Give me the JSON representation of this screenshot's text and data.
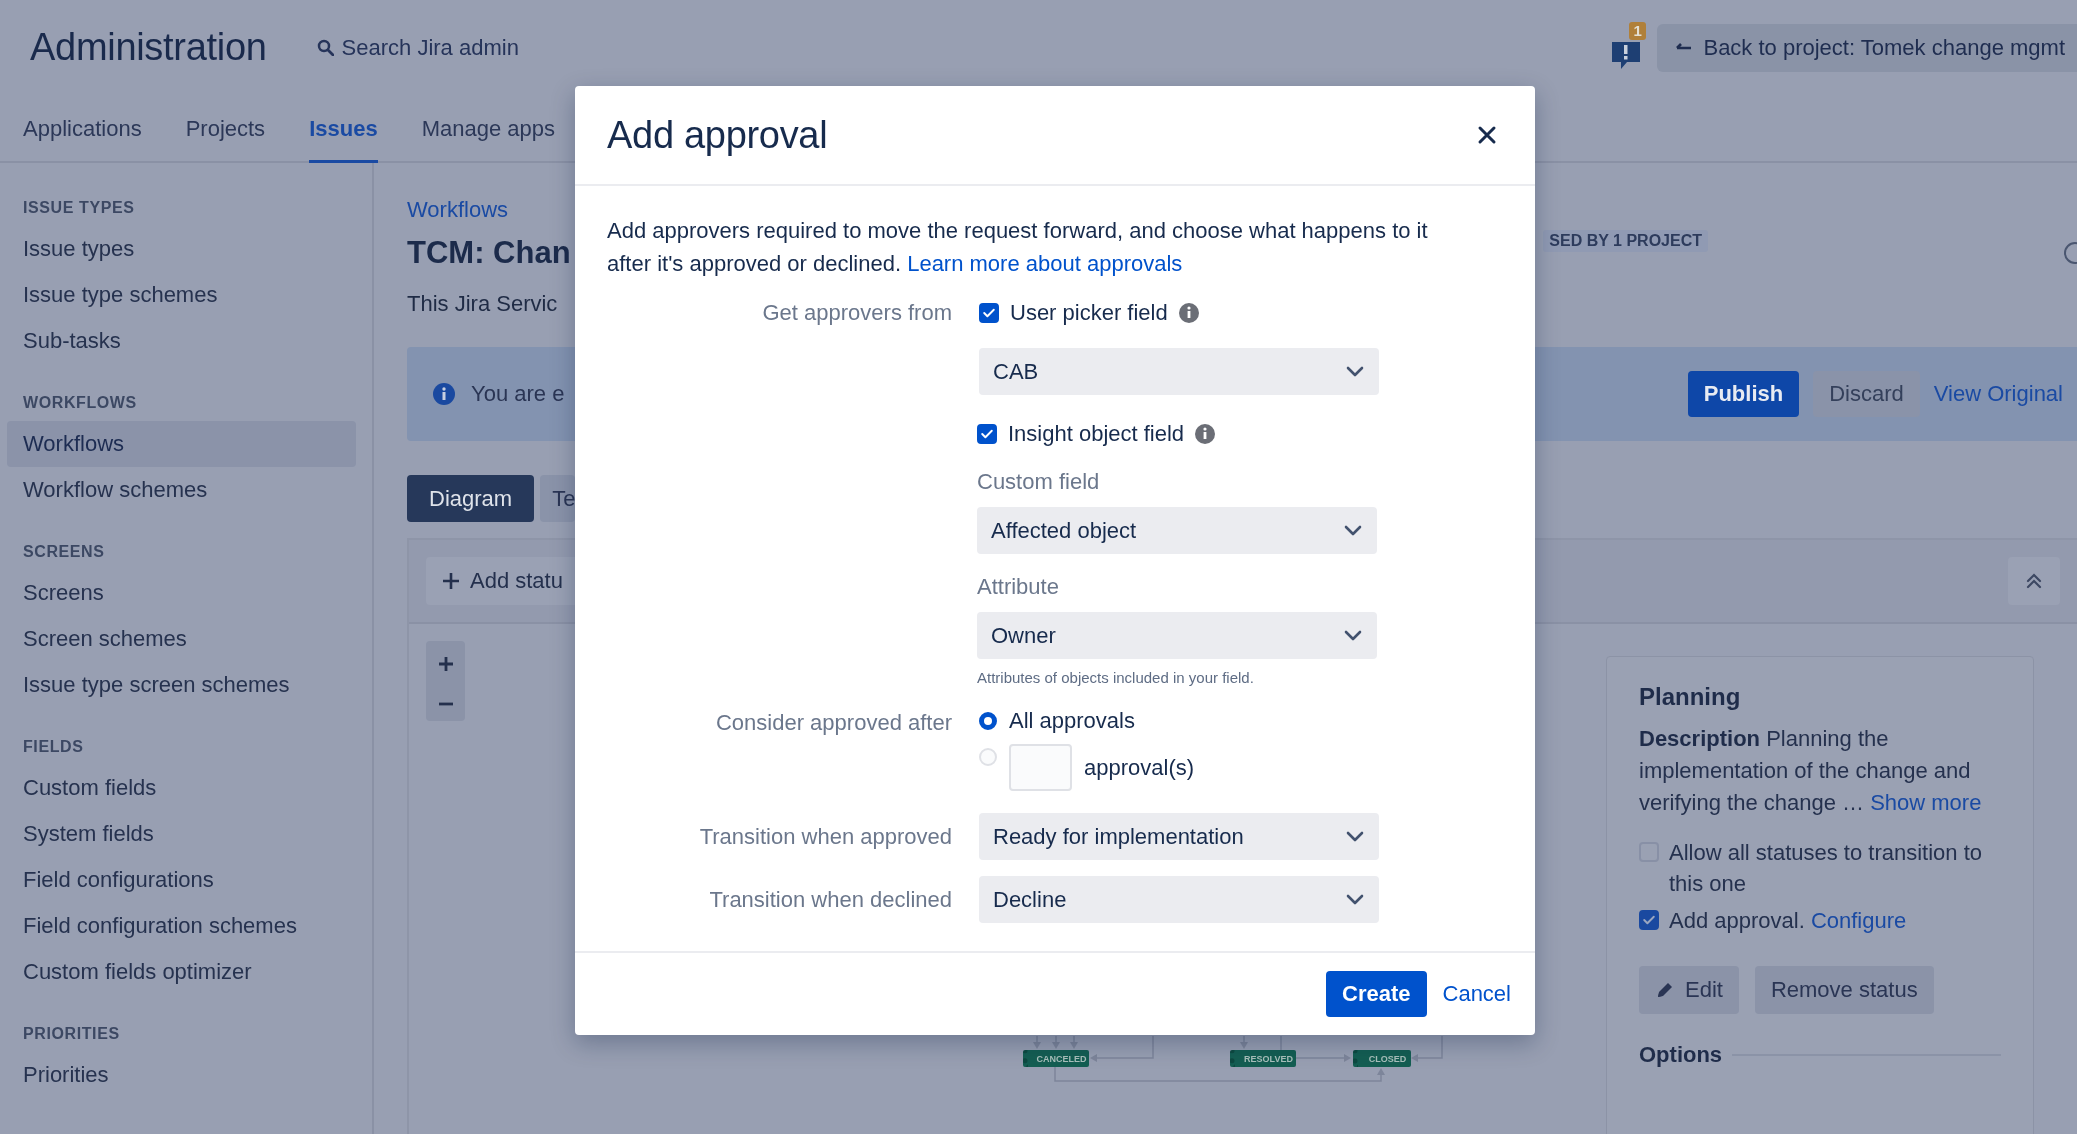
{
  "header": {
    "title": "Administration",
    "search_placeholder": "Search Jira admin",
    "notification_count": "1",
    "back_button": "Back to project: Tomek change mgmt"
  },
  "nav_tabs": [
    {
      "label": "Applications",
      "selected": false
    },
    {
      "label": "Projects",
      "selected": false
    },
    {
      "label": "Issues",
      "selected": true
    },
    {
      "label": "Manage apps",
      "selected": false
    }
  ],
  "sidebar": {
    "sections": [
      {
        "heading": "ISSUE TYPES",
        "items": [
          {
            "label": "Issue types",
            "selected": false
          },
          {
            "label": "Issue type schemes",
            "selected": false
          },
          {
            "label": "Sub-tasks",
            "selected": false
          }
        ]
      },
      {
        "heading": "WORKFLOWS",
        "items": [
          {
            "label": "Workflows",
            "selected": true
          },
          {
            "label": "Workflow schemes",
            "selected": false
          }
        ]
      },
      {
        "heading": "SCREENS",
        "items": [
          {
            "label": "Screens",
            "selected": false
          },
          {
            "label": "Screen schemes",
            "selected": false
          },
          {
            "label": "Issue type screen schemes",
            "selected": false
          }
        ]
      },
      {
        "heading": "FIELDS",
        "items": [
          {
            "label": "Custom fields",
            "selected": false
          },
          {
            "label": "System fields",
            "selected": false
          },
          {
            "label": "Field configurations",
            "selected": false
          },
          {
            "label": "Field configuration schemes",
            "selected": false
          },
          {
            "label": "Custom fields optimizer",
            "selected": false
          }
        ]
      },
      {
        "heading": "PRIORITIES",
        "items": [
          {
            "label": "Priorities",
            "selected": false
          }
        ]
      }
    ]
  },
  "main": {
    "breadcrumb": "Workflows",
    "title": "TCM: Chan",
    "project_badge": "SED BY 1 PROJECT",
    "description": "This Jira Servic",
    "banner": {
      "text": "You are e",
      "buttons": [
        {
          "label": "Publish",
          "kind": "primary"
        },
        {
          "label": "Discard",
          "kind": "default"
        },
        {
          "label": "View Original",
          "kind": "link"
        }
      ]
    },
    "view_tabs": [
      {
        "label": "Diagram",
        "selected": true
      },
      {
        "label": "Te",
        "selected": false
      }
    ],
    "add_status_button": "Add statu",
    "diagram": {
      "statuses": [
        {
          "name": "CANCELED"
        },
        {
          "name": "RESOLVED"
        },
        {
          "name": "CLOSED"
        }
      ]
    },
    "status_panel": {
      "title": "Planning",
      "description": "**Description** Planning the implementation of the change and verifying the change    …",
      "show_more": "Show more",
      "options": [
        {
          "label": "Allow all statuses to transition to this one",
          "checked": false
        },
        {
          "label": "Add approval.",
          "link": "Configure",
          "checked": true
        }
      ],
      "buttons": [
        {
          "label": "Edit",
          "kind": "edit"
        },
        {
          "label": "Remove status",
          "kind": "plain"
        }
      ],
      "section_title": "Options"
    }
  },
  "dialog": {
    "title": "Add approval",
    "intro": "Add approvers required to move the request forward, and choose what happens to it after it's approved or declined.",
    "intro_link": "Learn more about approvals",
    "approvers_label": "Get approvers from",
    "user_picker": {
      "label": "User picker field",
      "checked": true,
      "value": "CAB"
    },
    "insight": {
      "label": "Insight object field",
      "checked": true,
      "custom_field_label": "Custom field",
      "custom_field_value": "Affected object",
      "attribute_label": "Attribute",
      "attribute_value": "Owner",
      "help": "Attributes of objects included in your field."
    },
    "consider_label": "Consider approved after",
    "approval_options": [
      {
        "label": "All approvals",
        "selected": true,
        "kind": "plain"
      },
      {
        "label": "approval(s)",
        "selected": false,
        "kind": "count"
      }
    ],
    "transitions": [
      {
        "label": "Transition when approved",
        "value": "Ready for implementation"
      },
      {
        "label": "Transition when declined",
        "value": "Decline"
      }
    ],
    "buttons": [
      {
        "label": "Create",
        "kind": "primary"
      },
      {
        "label": "Cancel",
        "kind": "link"
      }
    ]
  }
}
